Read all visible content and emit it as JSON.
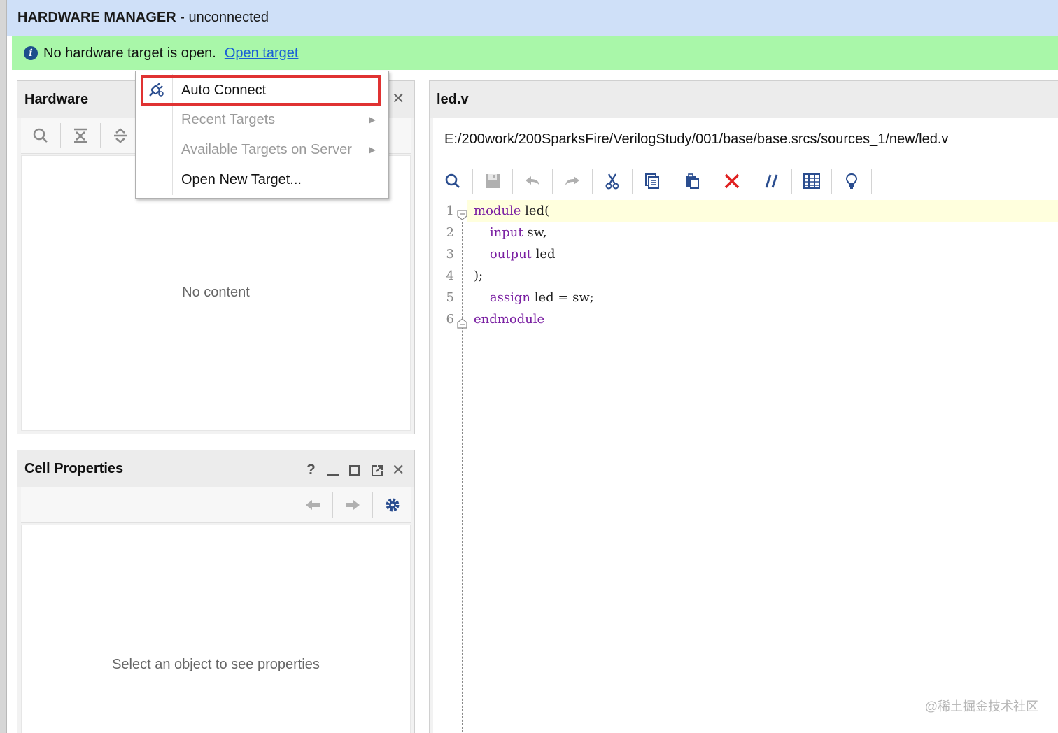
{
  "window": {
    "title_bold": "HARDWARE MANAGER",
    "title_rest": " - unconnected"
  },
  "banner": {
    "message": "No hardware target is open.",
    "link": "Open target",
    "icon": "info-icon"
  },
  "hardware_panel": {
    "title": "Hardware",
    "placeholder": "No content",
    "toolbar_icons": [
      "search-icon",
      "collapse-all-icon",
      "expand-all-icon",
      "gear-icon"
    ]
  },
  "context_menu": {
    "items": [
      {
        "label": "Auto Connect",
        "enabled": true,
        "icon": "auto-connect-icon",
        "submenu": false
      },
      {
        "label": "Recent Targets",
        "enabled": false,
        "submenu": true
      },
      {
        "label": "Available Targets on Server",
        "enabled": false,
        "submenu": true
      },
      {
        "label": "Open New Target...",
        "enabled": true,
        "submenu": false
      }
    ]
  },
  "cell_properties": {
    "title": "Cell Properties",
    "placeholder": "Select an object to see properties",
    "header_icons": [
      "help-icon",
      "minimize-icon",
      "maximize-icon",
      "float-icon",
      "close-icon"
    ],
    "toolbar_icons": [
      "back-icon",
      "forward-icon",
      "gear-icon"
    ]
  },
  "editor": {
    "tab_title": "led.v",
    "file_path": "E:/200work/200SparksFire/VerilogStudy/001/base/base.srcs/sources_1/new/led.v",
    "toolbar_icons": [
      "search-icon",
      "save-icon",
      "undo-icon",
      "redo-icon",
      "cut-icon",
      "copy-icon",
      "paste-icon",
      "delete-icon",
      "comment-icon",
      "columns-icon",
      "lightbulb-icon"
    ],
    "highlight_color": "#ffffdd",
    "keyword_color": "#7a1fa2",
    "lines": [
      {
        "num": "1",
        "kw": "module",
        "rest": " led("
      },
      {
        "num": "2",
        "kw": "    input",
        "rest": " sw,"
      },
      {
        "num": "3",
        "kw": "    output",
        "rest": " led"
      },
      {
        "num": "4",
        "kw": "",
        "rest": ");"
      },
      {
        "num": "5",
        "kw": "    assign",
        "rest": " led = sw;"
      },
      {
        "num": "6",
        "kw": "endmodule",
        "rest": ""
      }
    ]
  },
  "watermark": "@稀土掘金技术社区"
}
